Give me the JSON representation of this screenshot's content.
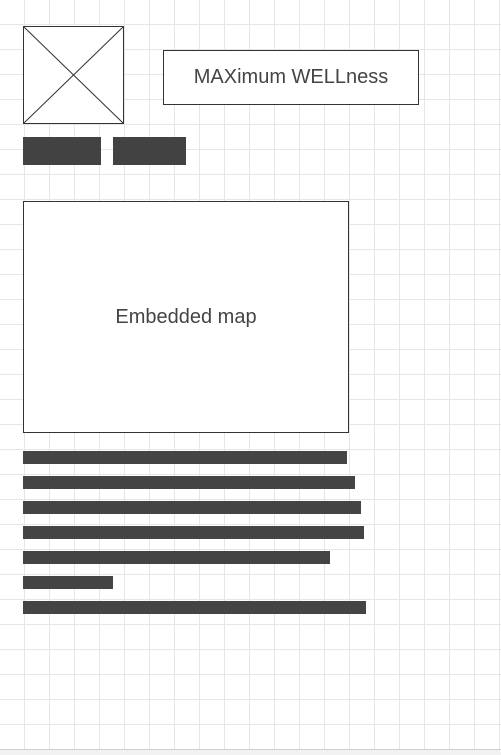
{
  "header": {
    "title": "MAXimum WELLness",
    "logo_icon": "image-placeholder-icon"
  },
  "nav": {
    "buttons": [
      {
        "label": ""
      },
      {
        "label": ""
      }
    ]
  },
  "main": {
    "map_label": "Embedded map"
  },
  "text_block": {
    "line_count": 7
  },
  "colors": {
    "placeholder_bar": "#424242",
    "border": "#333333",
    "grid": "#e6e6e6"
  }
}
